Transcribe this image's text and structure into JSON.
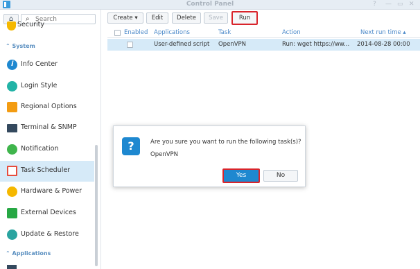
{
  "window": {
    "title": "Control Panel",
    "controls": [
      "?",
      "—",
      "▭",
      "✕"
    ]
  },
  "sidebar": {
    "search_placeholder": "Search",
    "partial_item": "Security",
    "section_system": "System",
    "items": [
      {
        "label": "Info Center",
        "icon": "info-icon",
        "color": "#1e88d0"
      },
      {
        "label": "Login Style",
        "icon": "palette-icon",
        "color": "#22b3a6"
      },
      {
        "label": "Regional Options",
        "icon": "regional-clock-icon",
        "color": "#f39c12"
      },
      {
        "label": "Terminal & SNMP",
        "icon": "terminal-icon",
        "color": "#34495e"
      },
      {
        "label": "Notification",
        "icon": "notification-chat-icon",
        "color": "#3fb54c"
      },
      {
        "label": "Task Scheduler",
        "icon": "task-scheduler-icon",
        "color": "#e74c3c",
        "active": true
      },
      {
        "label": "Hardware & Power",
        "icon": "lightbulb-icon",
        "color": "#f5b800"
      },
      {
        "label": "External Devices",
        "icon": "external-device-icon",
        "color": "#27a844"
      },
      {
        "label": "Update & Restore",
        "icon": "update-restore-icon",
        "color": "#2aa4a0"
      }
    ],
    "section_applications": "Applications"
  },
  "toolbar": {
    "create": "Create ▾",
    "edit": "Edit",
    "delete": "Delete",
    "save": "Save",
    "run": "Run"
  },
  "grid": {
    "headers": {
      "enabled": "Enabled",
      "applications": "Applications",
      "task": "Task",
      "action": "Action",
      "next_run": "Next run time ▴"
    },
    "row": {
      "application": "User-defined script",
      "task": "OpenVPN",
      "action": "Run: wget https://ww...",
      "next_run": "2014-08-28 00:00"
    }
  },
  "dialog": {
    "message": "Are you sure you want to run the following task(s)?",
    "task": "OpenVPN",
    "yes": "Yes",
    "no": "No"
  },
  "colors": {
    "accent": "#1e88d0",
    "highlight": "#d9242b",
    "selection": "#d6eaf8"
  }
}
